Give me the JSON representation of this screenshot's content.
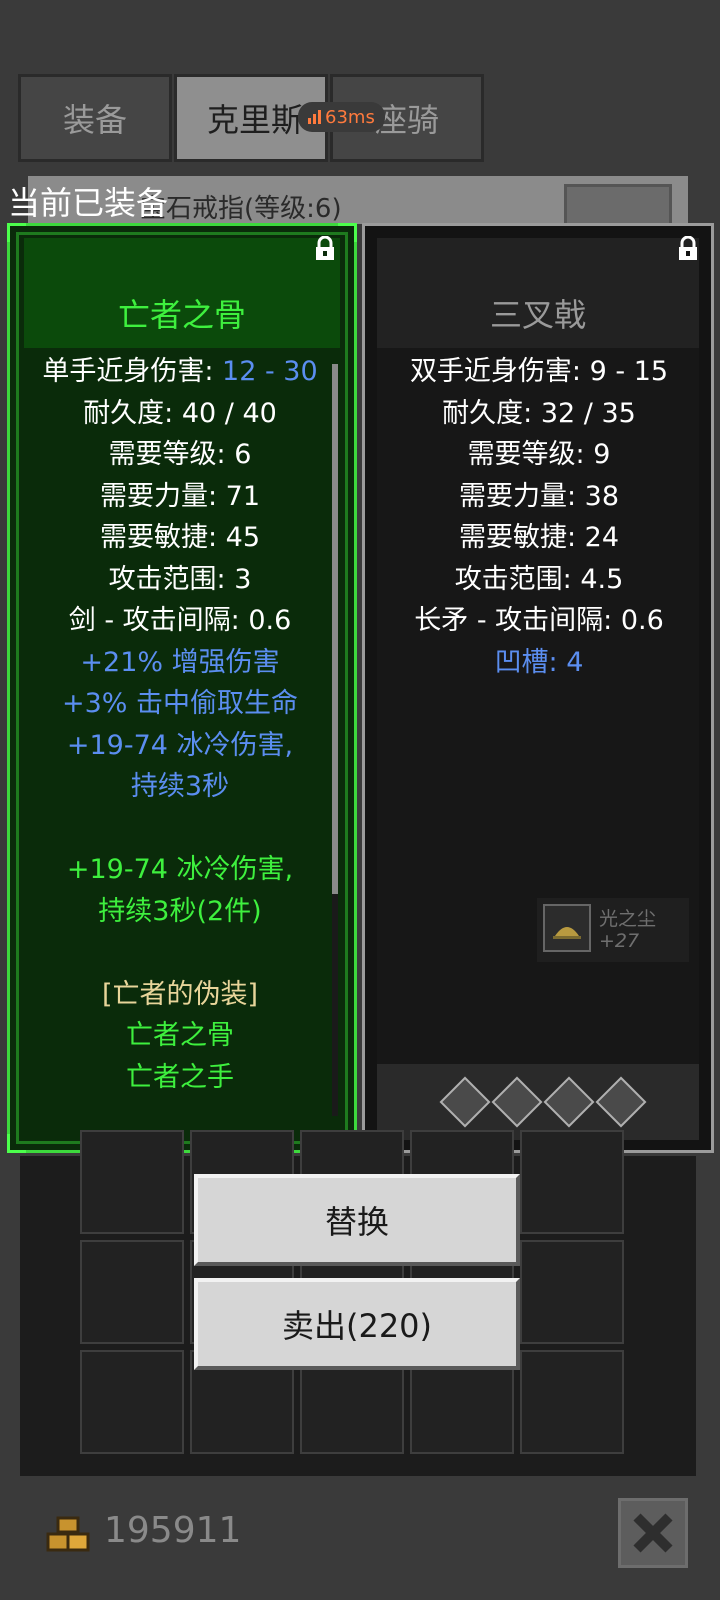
{
  "tabs": [
    {
      "label": "装备",
      "active": false
    },
    {
      "label": "克里斯",
      "active": true
    },
    {
      "label": "座骑",
      "active": false
    }
  ],
  "ping": {
    "text": "63ms",
    "color": "#ff7a3d"
  },
  "background_item": {
    "text": "宝石戒指(等级:6)"
  },
  "equipped_label": "当前已装备",
  "left_item": {
    "name": "亡者之骨",
    "stats": [
      {
        "label": "单手近身伤害: ",
        "value": "12 - 30",
        "valueColor": "#5b8ef0"
      },
      {
        "text": "耐久度: 40 / 40",
        "color": "#ffffff"
      },
      {
        "text": "需要等级: 6",
        "color": "#ffffff"
      },
      {
        "text": "需要力量: 71",
        "color": "#ffffff"
      },
      {
        "text": "需要敏捷: 45",
        "color": "#ffffff"
      },
      {
        "text": "攻击范围: 3",
        "color": "#ffffff"
      },
      {
        "text": "剑 - 攻击间隔: 0.6",
        "color": "#ffffff"
      },
      {
        "text": "+21% 增强伤害",
        "color": "#5b8ef0"
      },
      {
        "text": "+3% 击中偷取生命",
        "color": "#5b8ef0"
      },
      {
        "text": "+19-74 冰冷伤害,",
        "color": "#5b8ef0"
      },
      {
        "text": "持续3秒",
        "color": "#5b8ef0"
      },
      {
        "text": "",
        "color": "#ffffff"
      },
      {
        "text": "+19-74 冰冷伤害,",
        "color": "#3ef03e"
      },
      {
        "text": "持续3秒(2件)",
        "color": "#3ef03e"
      },
      {
        "text": "",
        "color": "#ffffff"
      },
      {
        "text": "[亡者的伪装]",
        "color": "#e8d59a"
      },
      {
        "text": "亡者之骨",
        "color": "#3ef03e"
      },
      {
        "text": "亡者之手",
        "color": "#3ef03e"
      }
    ]
  },
  "right_item": {
    "name": "三叉戟",
    "stats": [
      {
        "text": "双手近身伤害: 9 - 15",
        "color": "#ffffff"
      },
      {
        "text": "耐久度: 32 / 35",
        "color": "#ffffff"
      },
      {
        "text": "需要等级: 9",
        "color": "#ffffff"
      },
      {
        "text": "需要力量: 38",
        "color": "#ffffff"
      },
      {
        "text": "需要敏捷: 24",
        "color": "#ffffff"
      },
      {
        "text": "攻击范围: 4.5",
        "color": "#ffffff"
      },
      {
        "text": "长矛 - 攻击间隔: 0.6",
        "color": "#ffffff"
      },
      {
        "text": "凹槽: 4",
        "color": "#5b8ef0"
      }
    ],
    "sockets": 4,
    "dust": {
      "name": "光之尘",
      "count": "+27"
    }
  },
  "buttons": {
    "replace": "替换",
    "sell": "卖出(220)"
  },
  "gold": "195911",
  "colors": {
    "green_title": "#3ef03e",
    "gray_title": "#9a9a9a"
  }
}
